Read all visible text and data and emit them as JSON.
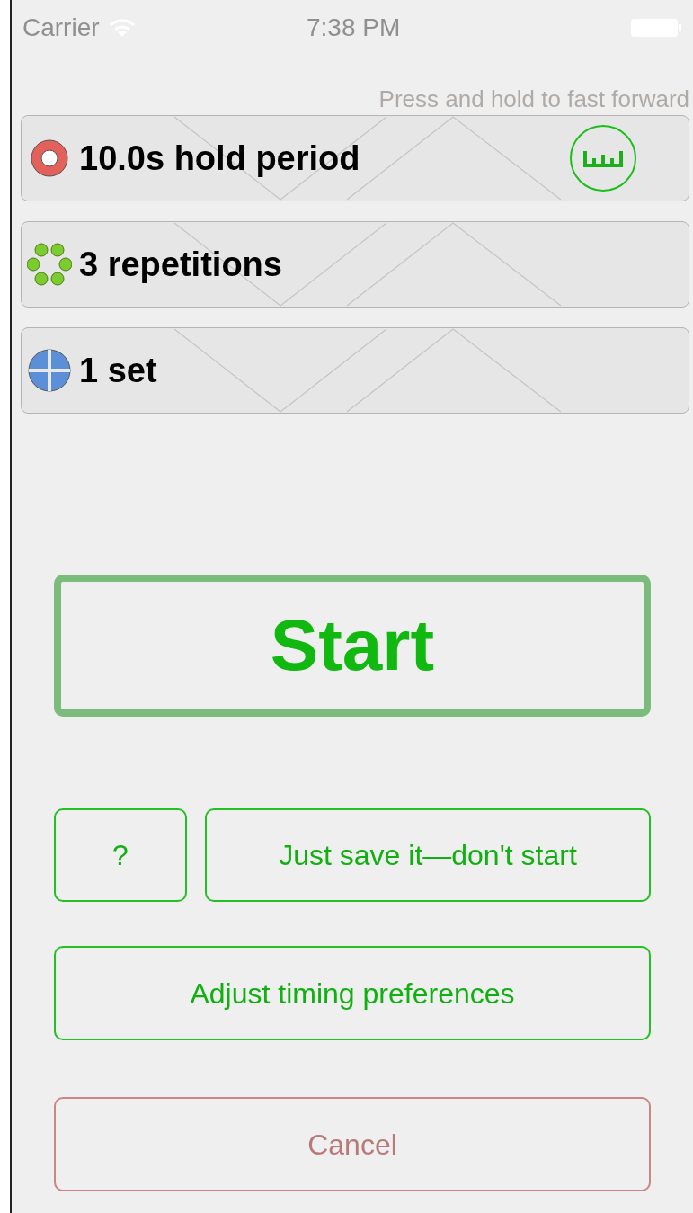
{
  "status_bar": {
    "carrier": "Carrier",
    "time": "7:38 PM"
  },
  "hint": "Press and hold to fast forward",
  "settings": [
    {
      "kind": "ring",
      "label": "10.0s hold period",
      "ruler": true
    },
    {
      "kind": "dots",
      "label": "3 repetitions",
      "ruler": false
    },
    {
      "kind": "quad",
      "label": "1 set",
      "ruler": false
    }
  ],
  "start_button": "Start",
  "help_button": "?",
  "save_button": "Just save it—don't start",
  "preferences_button": "Adjust timing preferences",
  "cancel_button": "Cancel"
}
